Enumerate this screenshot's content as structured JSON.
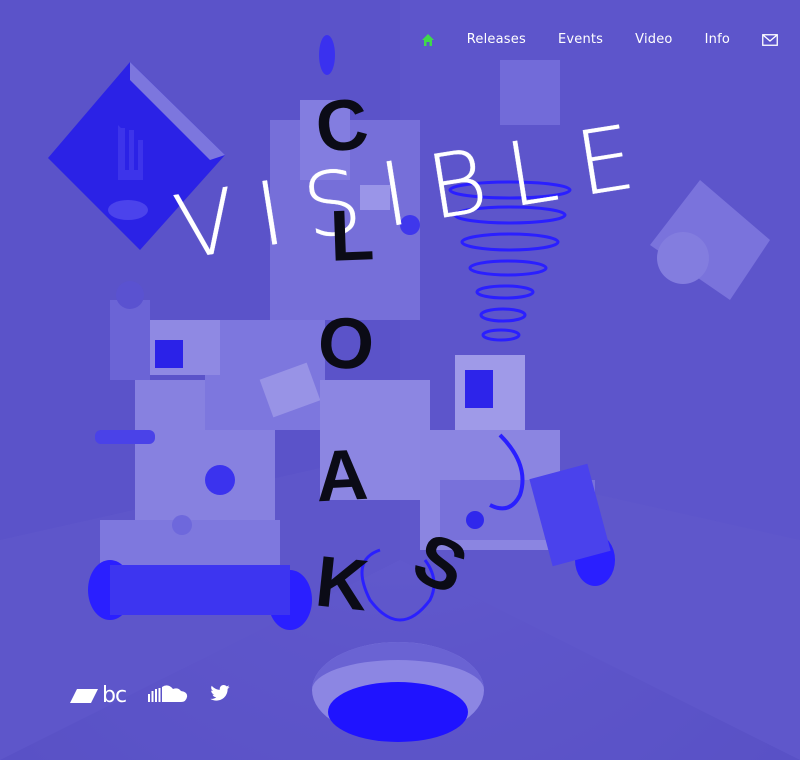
{
  "nav": {
    "home_icon": "home-icon",
    "items": [
      "Releases",
      "Events",
      "Video",
      "Info"
    ],
    "mail_icon": "mail-icon",
    "home_color": "#3fd94a"
  },
  "hero": {
    "word_visible": "VISIBLE",
    "cloaks_letters": [
      "C",
      "L",
      "O",
      "A",
      "K",
      "S"
    ]
  },
  "social": {
    "bandcamp_text": "bc",
    "bandcamp_icon": "bandcamp-icon",
    "soundcloud_icon": "soundcloud-icon",
    "twitter_icon": "twitter-icon"
  },
  "colors": {
    "background": "#5a52c8",
    "accent_blue": "#2a1fff",
    "title_white": "#ffffff",
    "title_black": "#0b0b16"
  }
}
